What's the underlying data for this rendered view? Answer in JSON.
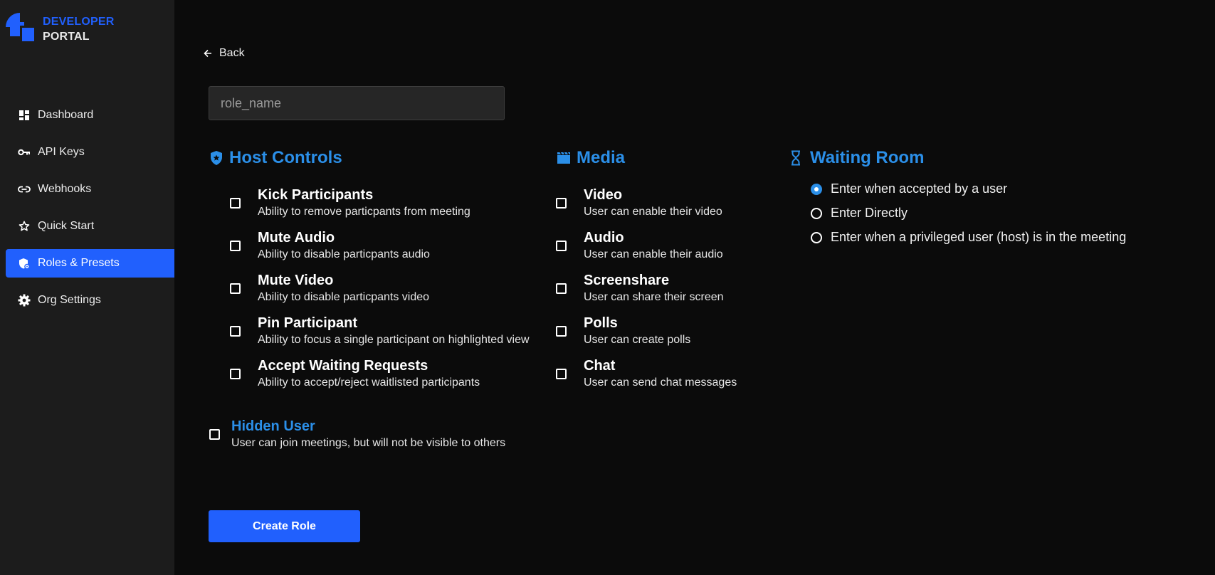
{
  "brand": {
    "line1": "DEVELOPER",
    "line2": "PORTAL",
    "accent": "#2160fd"
  },
  "sidebar": {
    "items": [
      {
        "label": "Dashboard",
        "icon": "dashboard-icon",
        "active": false
      },
      {
        "label": "API Keys",
        "icon": "key-icon",
        "active": false
      },
      {
        "label": "Webhooks",
        "icon": "link-icon",
        "active": false
      },
      {
        "label": "Quick Start",
        "icon": "star-icon",
        "active": false
      },
      {
        "label": "Roles & Presets",
        "icon": "shield-settings-icon",
        "active": true
      },
      {
        "label": "Org Settings",
        "icon": "gear-icon",
        "active": false
      }
    ]
  },
  "back": {
    "label": "Back"
  },
  "role_name": {
    "placeholder": "role_name",
    "value": ""
  },
  "host_controls": {
    "title": "Host Controls",
    "options": [
      {
        "title": "Kick Participants",
        "desc": "Ability to remove particpants from meeting",
        "checked": false
      },
      {
        "title": "Mute Audio",
        "desc": "Ability to disable particpants audio",
        "checked": false
      },
      {
        "title": "Mute Video",
        "desc": "Ability to disable particpants video",
        "checked": false
      },
      {
        "title": "Pin Participant",
        "desc": "Ability to focus a single participant on highlighted view",
        "checked": false
      },
      {
        "title": "Accept Waiting Requests",
        "desc": "Ability to accept/reject waitlisted participants",
        "checked": false
      }
    ]
  },
  "media": {
    "title": "Media",
    "options": [
      {
        "title": "Video",
        "desc": "User can enable their video",
        "checked": false
      },
      {
        "title": "Audio",
        "desc": "User can enable their audio",
        "checked": false
      },
      {
        "title": "Screenshare",
        "desc": "User can share their screen",
        "checked": false
      },
      {
        "title": "Polls",
        "desc": "User can create polls",
        "checked": false
      },
      {
        "title": "Chat",
        "desc": "User can send chat messages",
        "checked": false
      }
    ]
  },
  "waiting_room": {
    "title": "Waiting Room",
    "options": [
      {
        "label": "Enter when accepted by a user",
        "selected": true
      },
      {
        "label": "Enter Directly",
        "selected": false
      },
      {
        "label": "Enter when a privileged user (host) is in the meeting",
        "selected": false
      }
    ]
  },
  "hidden_user": {
    "title": "Hidden User",
    "desc": "User can join meetings, but will not be visible to others",
    "checked": false
  },
  "create_button": {
    "label": "Create Role"
  },
  "colors": {
    "background": "#0b0b0b",
    "sidebar": "#1c1c1c",
    "primary": "#2160fd",
    "heading": "#2b8fe8"
  }
}
